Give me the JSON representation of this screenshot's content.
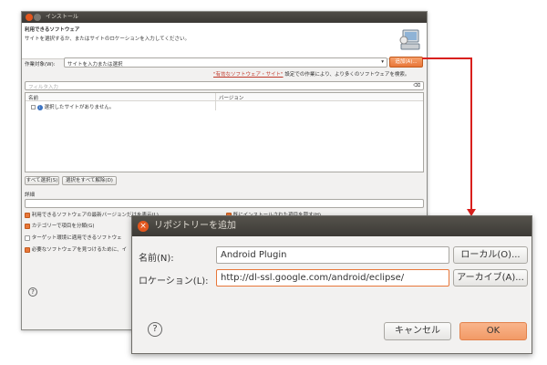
{
  "back_window": {
    "title": "インストール",
    "header_title": "利用できるソフトウェア",
    "header_subtitle": "サイトを選択するか、またはサイトのロケーションを入力してください。",
    "work_with_label": "作業対象(W):",
    "work_with_value": "サイトを入力または選択",
    "add_button": "追加(A)...",
    "hint_link": "\"有効なソフトウェア・サイト\"",
    "hint_text": "設定での作業により、より多くのソフトウェアを検索。",
    "filter_placeholder": "フィルタ入力",
    "table_headers": [
      "名前",
      "バージョン"
    ],
    "table_message": "選択したサイトがありません。",
    "select_all": "すべて選択(S)",
    "deselect_all": "選択をすべて解除(D)",
    "details_label": "詳細",
    "options": [
      {
        "label": "利用できるソフトウェアの最新バージョンだけを表示(L)",
        "checked": true
      },
      {
        "label": "既にインストールされた項目を隠す(H)",
        "checked": true
      },
      {
        "label": "カテゴリーで項目を分類(G)",
        "checked": true
      },
      {
        "label": "ターゲット環境に適用できるソフトウェ",
        "checked": false
      },
      {
        "label": "必要なソフトウェアを見つけるために、イ",
        "checked": true
      }
    ],
    "help_glyph": "?"
  },
  "dialog": {
    "title": "リポジトリーを追加",
    "name_label": "名前(N):",
    "name_value": "Android Plugin",
    "local_button": "ローカル(O)...",
    "location_label": "ロケーション(L):",
    "location_value": "http://dl-ssl.google.com/android/eclipse/",
    "archive_button": "アーカイブ(A)...",
    "cancel_button": "キャンセル",
    "ok_button": "OK",
    "help_glyph": "?"
  },
  "colors": {
    "accent": "#e8773a",
    "arrow": "#d9201d",
    "titlebar": "#3c3a36"
  }
}
